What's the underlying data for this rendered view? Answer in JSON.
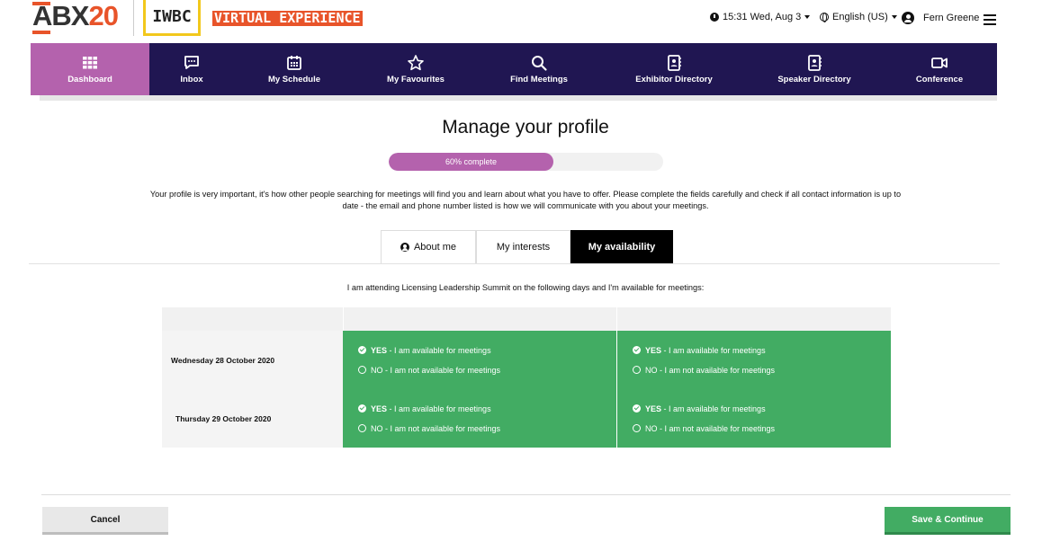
{
  "header": {
    "logo_abx_a": "A",
    "logo_abx_rest": "BX",
    "logo_abx_num": "20",
    "logo_iwbc": "IWBC",
    "logo_tagline": "VIRTUAL EXPERIENCE",
    "datetime": "15:31 Wed, Aug 3",
    "language": "English (US)",
    "user_name": "Fern Greene"
  },
  "nav": {
    "items": [
      {
        "label": "Dashboard",
        "icon": "grid-icon"
      },
      {
        "label": "Inbox",
        "icon": "chat-icon"
      },
      {
        "label": "My Schedule",
        "icon": "calendar-icon"
      },
      {
        "label": "My Favourites",
        "icon": "star-icon"
      },
      {
        "label": "Find Meetings",
        "icon": "search-icon"
      },
      {
        "label": "Exhibitor Directory",
        "icon": "directory-icon"
      },
      {
        "label": "Speaker Directory",
        "icon": "directory-icon"
      },
      {
        "label": "Conference",
        "icon": "video-icon"
      }
    ],
    "active": "Dashboard"
  },
  "page": {
    "title": "Manage your profile",
    "progress_label": "60% complete",
    "progress_value": 0.6,
    "intro": "Your profile is very important, it's how other people searching for meetings will find you and learn about what you have to offer. Please complete the fields carefully and check if all contact information is up to date - the email and phone number listed is how we will communicate with you about your meetings."
  },
  "tabs": {
    "about": "About me",
    "interests": "My interests",
    "availability": "My availability"
  },
  "availability": {
    "intro": "I am attending Licensing Leadership Summit  on the following days and I'm available for meetings:",
    "yes_bold": "YES",
    "yes_rest": " - I am available for meetings",
    "no_text": "NO - I am not available for meetings",
    "rows": [
      {
        "day": "Wednesday 28 October 2020"
      },
      {
        "day": "Thursday 29 October 2020"
      }
    ]
  },
  "footer": {
    "cancel": "Cancel",
    "save": "Save & Continue"
  },
  "colors": {
    "nav_bg": "#201652",
    "accent_purple": "#b462ad",
    "green": "#42ac63",
    "brand_orange": "#e8542a",
    "brand_yellow": "#f2c81c"
  }
}
